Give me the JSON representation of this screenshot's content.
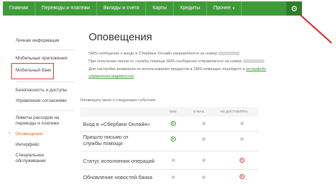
{
  "topnav": {
    "items": [
      "Главная",
      "Переводы и платежи",
      "Вклады и счета",
      "Карты",
      "Кредиты",
      "Прочее"
    ],
    "more_caret": "▾",
    "gear_glyph": "⚙"
  },
  "sidebar": {
    "items": [
      {
        "label": "Личная информация",
        "active": false
      },
      {
        "label": "Мобильные приложения",
        "active": false
      },
      {
        "label": "Мобильный банк",
        "active": false
      },
      {
        "label": "Безопасность и доступы",
        "active": false
      },
      {
        "label": "Управление согласиями",
        "active": false
      },
      {
        "label": "Лимиты расходов на переводы и платежи",
        "active": false
      },
      {
        "label": "Оповещения",
        "active": true
      },
      {
        "label": "Интерфейс",
        "active": false
      },
      {
        "label": "Специальное обслуживание",
        "active": false
      }
    ],
    "active_arrow": "›"
  },
  "main": {
    "title": "Оповещения",
    "info_lines": [
      "SMS-сообщения о входе в Сбербанк Онлайн направляются на номер",
      "При получении писем от службы помощи SMS-сообщения отправляются на номер",
      "Для настройки возможности использования продуктов в SMS-командах перейдите в"
    ],
    "info_link_part1": "интерфейс",
    "info_link_part2": "управления видимостью",
    "subtitle": "Оповещать меня о следующих событиях",
    "columns": [
      "SMS",
      "E-MAIL",
      "НЕ ДОСТАВЛЯТЬ"
    ],
    "rows": [
      {
        "label": "Вход в «Сбербанк Онлайн»",
        "selected": "sms"
      },
      {
        "label": "Пришло письмо от службы помощи",
        "selected": "sms"
      },
      {
        "label": "Статус исполнения операций",
        "selected": "none"
      },
      {
        "label": "Обновление новостей банка",
        "selected": "none"
      }
    ]
  },
  "colors": {
    "nav_green": "#3f9b3a",
    "accent_orange": "#e26a1b",
    "radio_green": "#3d9b38",
    "radio_red": "#dd3d3d",
    "annotation_red": "#e33"
  }
}
